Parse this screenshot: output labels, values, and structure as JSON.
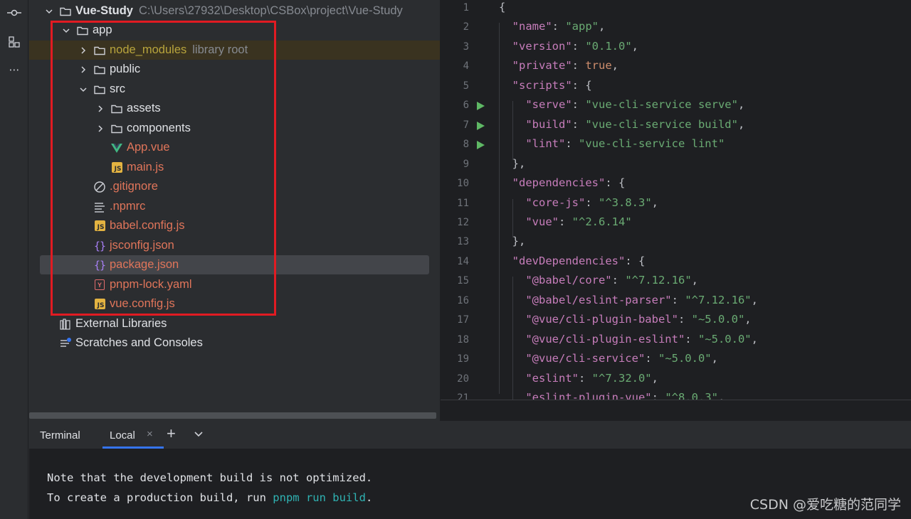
{
  "activity_bar": {
    "icons": [
      "commit-icon",
      "structure-icon",
      "more-icon"
    ],
    "more_glyph": "⋯"
  },
  "project_tree": {
    "root": {
      "label": "Vue-Study",
      "path": "C:\\Users\\27932\\Desktop\\CSBox\\project\\Vue-Study"
    },
    "items": [
      {
        "label": "app"
      },
      {
        "label": "node_modules",
        "hint": "library root"
      },
      {
        "label": "public"
      },
      {
        "label": "src"
      },
      {
        "label": "assets"
      },
      {
        "label": "components"
      },
      {
        "label": "App.vue"
      },
      {
        "label": "main.js"
      },
      {
        "label": ".gitignore"
      },
      {
        "label": ".npmrc"
      },
      {
        "label": "babel.config.js"
      },
      {
        "label": "jsconfig.json"
      },
      {
        "label": "package.json"
      },
      {
        "label": "pnpm-lock.yaml"
      },
      {
        "label": "vue.config.js"
      },
      {
        "label": "External Libraries"
      },
      {
        "label": "Scratches and Consoles"
      }
    ],
    "badges": {
      "js": "JS",
      "yaml": "Y",
      "braces": "{}"
    }
  },
  "editor": {
    "line_numbers": [
      "1",
      "2",
      "3",
      "4",
      "5",
      "6",
      "7",
      "8",
      "9",
      "10",
      "11",
      "12",
      "13",
      "14",
      "15",
      "16",
      "17",
      "18",
      "19",
      "20",
      "21"
    ],
    "lines": [
      [
        [
          "p",
          "{"
        ]
      ],
      [
        [
          "p",
          "  "
        ],
        [
          "k",
          "\"name\""
        ],
        [
          "p",
          ": "
        ],
        [
          "s",
          "\"app\""
        ],
        [
          "p",
          ","
        ]
      ],
      [
        [
          "p",
          "  "
        ],
        [
          "k",
          "\"version\""
        ],
        [
          "p",
          ": "
        ],
        [
          "s",
          "\"0.1.0\""
        ],
        [
          "p",
          ","
        ]
      ],
      [
        [
          "p",
          "  "
        ],
        [
          "k",
          "\"private\""
        ],
        [
          "p",
          ": "
        ],
        [
          "b",
          "true"
        ],
        [
          "p",
          ","
        ]
      ],
      [
        [
          "p",
          "  "
        ],
        [
          "k",
          "\"scripts\""
        ],
        [
          "p",
          ": {"
        ]
      ],
      [
        [
          "p",
          "    "
        ],
        [
          "k",
          "\"serve\""
        ],
        [
          "p",
          ": "
        ],
        [
          "s",
          "\"vue-cli-service serve\""
        ],
        [
          "p",
          ","
        ]
      ],
      [
        [
          "p",
          "    "
        ],
        [
          "k",
          "\"build\""
        ],
        [
          "p",
          ": "
        ],
        [
          "s",
          "\"vue-cli-service build\""
        ],
        [
          "p",
          ","
        ]
      ],
      [
        [
          "p",
          "    "
        ],
        [
          "k",
          "\"lint\""
        ],
        [
          "p",
          ": "
        ],
        [
          "s",
          "\"vue-cli-service lint\""
        ]
      ],
      [
        [
          "p",
          "  },"
        ]
      ],
      [
        [
          "p",
          "  "
        ],
        [
          "k",
          "\"dependencies\""
        ],
        [
          "p",
          ": {"
        ]
      ],
      [
        [
          "p",
          "    "
        ],
        [
          "k",
          "\"core-js\""
        ],
        [
          "p",
          ": "
        ],
        [
          "s",
          "\"^3.8.3\""
        ],
        [
          "p",
          ","
        ]
      ],
      [
        [
          "p",
          "    "
        ],
        [
          "k",
          "\"vue\""
        ],
        [
          "p",
          ": "
        ],
        [
          "s",
          "\"^2.6.14\""
        ]
      ],
      [
        [
          "p",
          "  },"
        ]
      ],
      [
        [
          "p",
          "  "
        ],
        [
          "k",
          "\"devDependencies\""
        ],
        [
          "p",
          ": {"
        ]
      ],
      [
        [
          "p",
          "    "
        ],
        [
          "k",
          "\"@babel/core\""
        ],
        [
          "p",
          ": "
        ],
        [
          "s",
          "\"^7.12.16\""
        ],
        [
          "p",
          ","
        ]
      ],
      [
        [
          "p",
          "    "
        ],
        [
          "k",
          "\"@babel/eslint-parser\""
        ],
        [
          "p",
          ": "
        ],
        [
          "s",
          "\"^7.12.16\""
        ],
        [
          "p",
          ","
        ]
      ],
      [
        [
          "p",
          "    "
        ],
        [
          "k",
          "\"@vue/cli-plugin-babel\""
        ],
        [
          "p",
          ": "
        ],
        [
          "s",
          "\"~5.0.0\""
        ],
        [
          "p",
          ","
        ]
      ],
      [
        [
          "p",
          "    "
        ],
        [
          "k",
          "\"@vue/cli-plugin-eslint\""
        ],
        [
          "p",
          ": "
        ],
        [
          "s",
          "\"~5.0.0\""
        ],
        [
          "p",
          ","
        ]
      ],
      [
        [
          "p",
          "    "
        ],
        [
          "k",
          "\"@vue/cli-service\""
        ],
        [
          "p",
          ": "
        ],
        [
          "s",
          "\"~5.0.0\""
        ],
        [
          "p",
          ","
        ]
      ],
      [
        [
          "p",
          "    "
        ],
        [
          "k",
          "\"eslint\""
        ],
        [
          "p",
          ": "
        ],
        [
          "s",
          "\"^7.32.0\""
        ],
        [
          "p",
          ","
        ]
      ],
      [
        [
          "p",
          "    "
        ],
        [
          "k",
          "\"eslint-plugin-vue\""
        ],
        [
          "p",
          ": "
        ],
        [
          "s",
          "\"^8.0.3\""
        ],
        [
          "p",
          ","
        ]
      ]
    ],
    "run_lines": [
      6,
      7,
      8
    ]
  },
  "terminal": {
    "title": "Terminal",
    "tab_label": "Local",
    "close_glyph": "×",
    "add_glyph": "+",
    "output": {
      "line1": "Note that the development build is not optimized.",
      "line2_prefix": "To create a production build, run ",
      "line2_cmd": "pnpm run build",
      "line2_suffix": "."
    }
  },
  "watermark": "CSDN @爱吃糖的范同学",
  "colors": {
    "accent": "#3574f0",
    "highlight_box": "#e11b22",
    "vue_file": "#e0755a",
    "excluded_folder": "#b8a43c",
    "run_icon": "#5fb865"
  }
}
